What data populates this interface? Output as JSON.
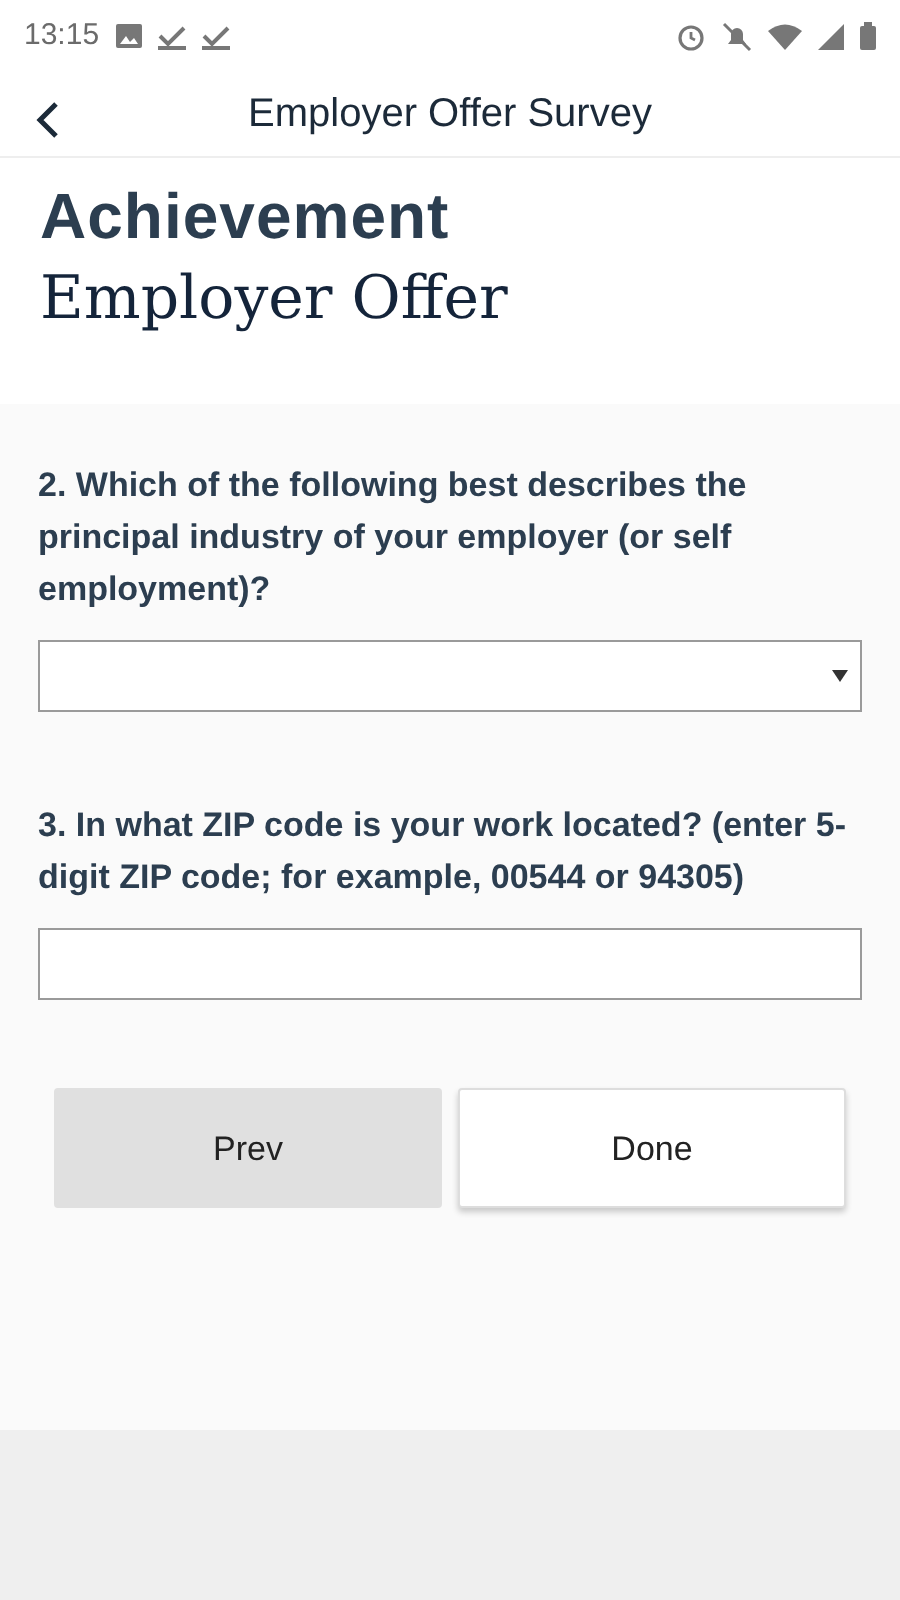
{
  "status_bar": {
    "time": "13:15"
  },
  "header": {
    "title": "Employer Offer Survey"
  },
  "brand": "Achievement",
  "page_title": "Employer Offer",
  "questions": [
    {
      "kind": "select",
      "label": "2. Which of the following best describes the principal industry of your employer (or self employment)?"
    },
    {
      "kind": "text",
      "label": "3. In what ZIP code is your work located? (enter 5-digit ZIP code; for example, 00544 or 94305)"
    }
  ],
  "buttons": [
    {
      "label": "Prev",
      "kind": "secondary"
    },
    {
      "label": "Done",
      "kind": "primary"
    }
  ]
}
